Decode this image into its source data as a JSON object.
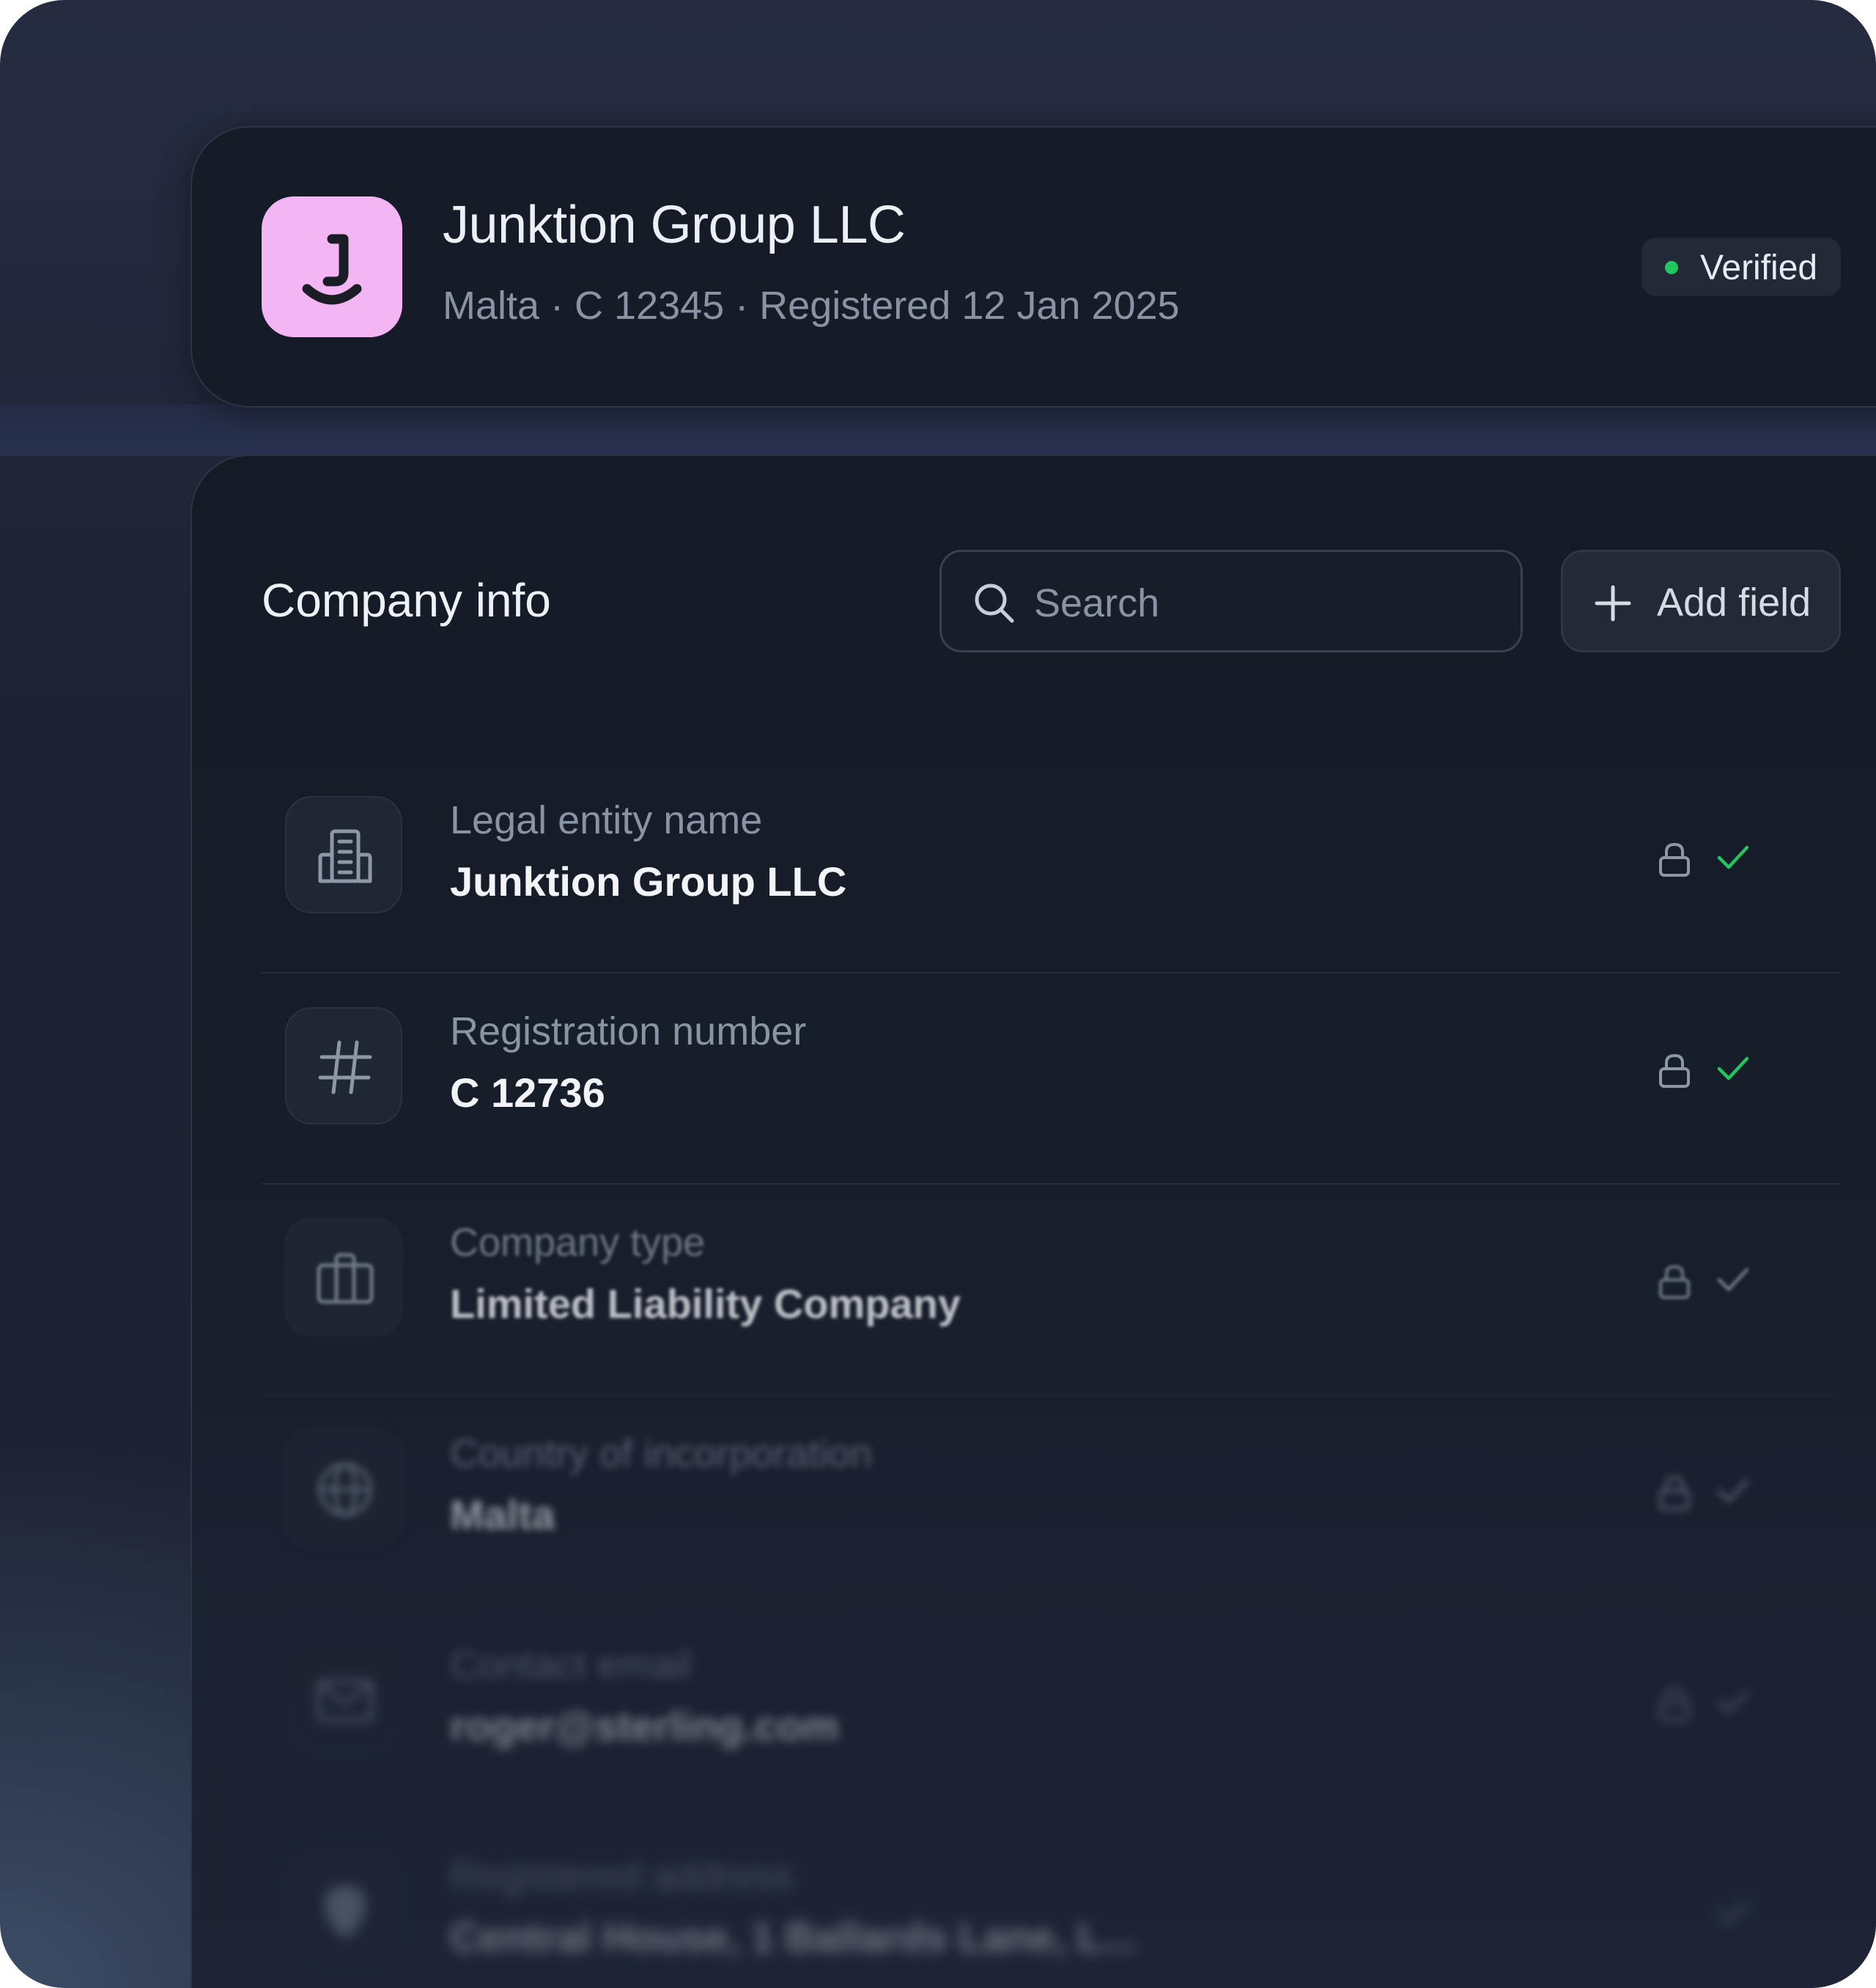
{
  "header": {
    "company_name": "Junktion Group LLC",
    "meta": "Malta · C 12345 · Registered 12 Jan 2025",
    "badge_label": "Verified",
    "logo_icon": "junktion-logo-icon",
    "logo_color": "#f4b5f5",
    "badge_dot_color": "#22c55e"
  },
  "section": {
    "title": "Company info",
    "search_placeholder": "Search",
    "add_field_label": "Add field"
  },
  "fields": [
    {
      "label": "Legal entity name",
      "value": "Junktion Group LLC",
      "icon": "building-icon",
      "locked": true,
      "verified": true
    },
    {
      "label": "Registration number",
      "value": "C 12736",
      "icon": "hash-icon",
      "locked": true,
      "verified": true
    },
    {
      "label": "Company type",
      "value": "Limited Liability Company",
      "icon": "briefcase-icon",
      "locked": true,
      "verified": true
    },
    {
      "label": "Country of incorporation",
      "value": "Malta",
      "icon": "globe-icon",
      "locked": true,
      "verified": true
    },
    {
      "label": "Contact email",
      "value": "roger@sterling.com",
      "icon": "mail-icon",
      "locked": true,
      "verified": true
    },
    {
      "label": "Registered address",
      "value": "Central House, 1 Ballards Lane, L...",
      "icon": "map-pin-icon",
      "locked": false,
      "verified": true
    }
  ],
  "colors": {
    "check": "#22c55e",
    "muted_text": "#8a93a3"
  }
}
